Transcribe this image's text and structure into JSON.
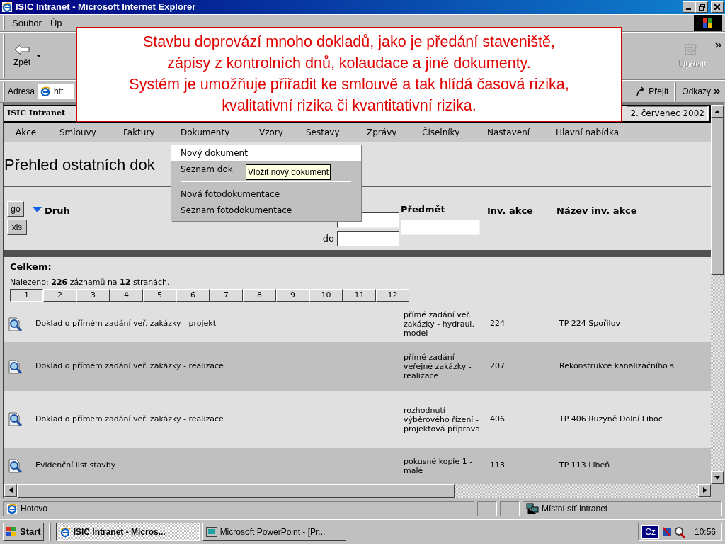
{
  "window": {
    "title": "ISIC Intranet - Microsoft Internet Explorer"
  },
  "menu_bar": [
    "Soubor",
    "Úp"
  ],
  "toolbar": [
    {
      "label": "Zpět",
      "disabled": false
    },
    {
      "label": "Upravit",
      "disabled": true
    }
  ],
  "address_bar": {
    "label": "Adresa",
    "value": "htt",
    "go": "Přejít",
    "links": "Odkazy"
  },
  "callout": [
    "Stavbu doprovází mnoho dokladů, jako je předání staveniště,",
    "zápisy z kontrolních dnů, kolaudace a jiné dokumenty.",
    "Systém je umožňuje přiřadit ke smlouvě a tak hlídá časová rizika,",
    "kvalitativní rizika či kvantitativní rizika."
  ],
  "page": {
    "title": "ISIC Intranet",
    "date": "2. červenec 2002",
    "nav": [
      "Akce",
      "Smlouvy",
      "Faktury",
      "Dokumenty",
      "Vzory",
      "Sestavy",
      "Zprávy",
      "Číselníky",
      "Nastavení",
      "Hlavní nabídka"
    ],
    "dropdown": [
      {
        "kind": "item",
        "label": "Nový dokument",
        "selected": true
      },
      {
        "kind": "item",
        "label": "Seznam dok",
        "selected": false
      },
      {
        "kind": "separator"
      },
      {
        "kind": "item",
        "label": "Nová fotodokumentace",
        "selected": false
      },
      {
        "kind": "item",
        "label": "Seznam fotodokumentace",
        "selected": false
      }
    ],
    "tooltip": "Vložit nový dokument",
    "heading": "Přehled ostatních dok",
    "filter": {
      "buttons": [
        "go",
        "xls"
      ],
      "sort_label": "Druh",
      "date_to": "do",
      "subject": "Předmět",
      "columns": [
        "Inv. akce",
        "Název inv. akce"
      ]
    },
    "summary": {
      "title": "Celkem:",
      "found": "Nalezeno: **226** záznamů na **12** stranách."
    },
    "pages": [
      {
        "label": "1",
        "selected": true
      },
      {
        "label": "2",
        "selected": false
      },
      {
        "label": "3",
        "selected": false
      },
      {
        "label": "4",
        "selected": false
      },
      {
        "label": "5",
        "selected": false
      },
      {
        "label": "6",
        "selected": false
      },
      {
        "label": "7",
        "selected": false
      },
      {
        "label": "8",
        "selected": false
      },
      {
        "label": "9",
        "selected": false
      },
      {
        "label": "10",
        "selected": false
      },
      {
        "label": "11",
        "selected": false
      },
      {
        "label": "12",
        "selected": false
      }
    ],
    "rows": [
      {
        "name": "Doklad o přímém zadání veř. zakázky - projekt",
        "description": "přímé zadání veř. zakázky - hydraul. model",
        "number": "224",
        "action": "TP 224 Spořilov"
      },
      {
        "name": "Doklad o přímém zadání veř. zakázky - realizace",
        "description": "přímé zadání veřejné zakázky - realizace",
        "number": "207",
        "action": "Rekonstrukce kanalizačního s"
      },
      {
        "name": "Doklad o přímém zadání veř. zakázky - realizace",
        "description": "rozhodnutí výběrového řízení - projektová příprava",
        "number": "406",
        "action": "TP 406 Ruzyně Dolní Liboc"
      },
      {
        "name": "Evidenční list stavby",
        "description": "pokusné kopie 1 - malé",
        "number": "113",
        "action": "TP 113 Libeň"
      }
    ]
  },
  "status_bar": {
    "text": "Hotovo",
    "zone": "Místní síť intranet"
  },
  "taskbar": {
    "start": "Start",
    "tasks": [
      {
        "label": "ISIC Intranet - Micros...",
        "selected": true
      },
      {
        "label": "Microsoft PowerPoint - [Pr...",
        "selected": false
      }
    ],
    "language": "Cz",
    "clock": "10:56"
  }
}
